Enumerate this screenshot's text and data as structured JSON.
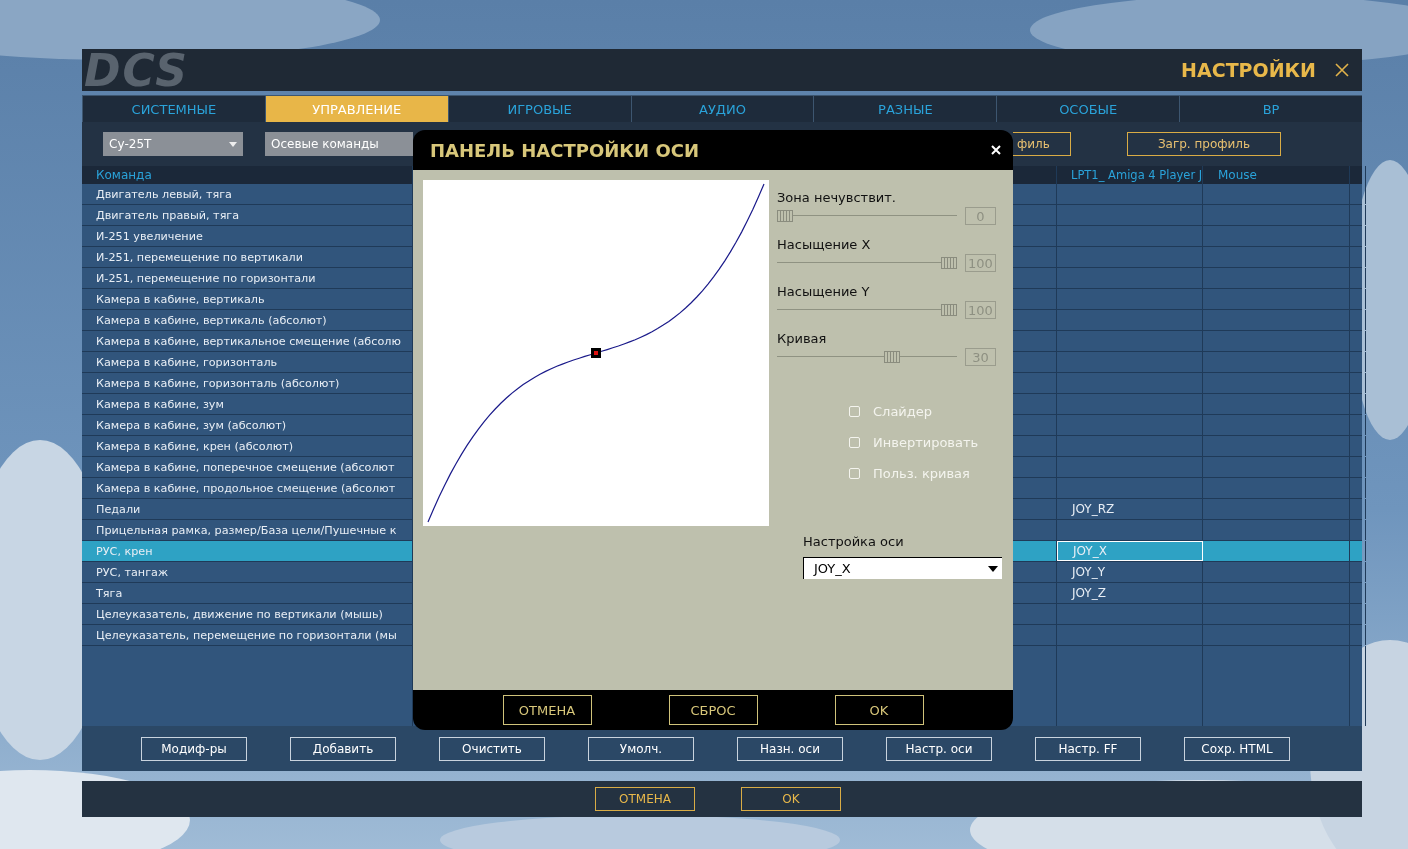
{
  "logo": "DCS",
  "window": {
    "title": "НАСТРОЙКИ"
  },
  "tabs": [
    {
      "label": "СИСТЕМНЫЕ",
      "selected": false
    },
    {
      "label": "УПРАВЛЕНИЕ",
      "selected": true
    },
    {
      "label": "ИГРОВЫЕ",
      "selected": false
    },
    {
      "label": "АУДИО",
      "selected": false
    },
    {
      "label": "РАЗНЫЕ",
      "selected": false
    },
    {
      "label": "ОСОБЫЕ",
      "selected": false
    },
    {
      "label": "ВР",
      "selected": false
    }
  ],
  "toolbar": {
    "aircraft": "Су-25Т",
    "category": "Осевые команды",
    "buttons": [
      "филь",
      "Загр. профиль"
    ]
  },
  "table": {
    "columns": [
      "Команда",
      "LPT1_ Amiga 4 Player J",
      "Mouse"
    ],
    "rows": [
      {
        "command": "Двигатель левый, тяга",
        "selected": false
      },
      {
        "command": "Двигатель правый, тяга",
        "selected": false
      },
      {
        "command": "И-251 увеличение",
        "selected": false
      },
      {
        "command": "И-251, перемещение по вертикали",
        "selected": false
      },
      {
        "command": "И-251, перемещение по горизонтали",
        "selected": false
      },
      {
        "command": "Камера в кабине, вертикаль",
        "selected": false
      },
      {
        "command": "Камера в кабине, вертикаль (абсолют)",
        "selected": false
      },
      {
        "command": "Камера в кабине, вертикальное смещение (абсолю",
        "selected": false
      },
      {
        "command": "Камера в кабине, горизонталь",
        "selected": false
      },
      {
        "command": "Камера в кабине, горизонталь (абсолют)",
        "selected": false
      },
      {
        "command": "Камера в кабине, зум",
        "selected": false
      },
      {
        "command": "Камера в кабине, зум (абсолют)",
        "selected": false
      },
      {
        "command": "Камера в кабине, крен (абсолют)",
        "selected": false
      },
      {
        "command": "Камера в кабине, поперечное смещение (абсолют",
        "selected": false
      },
      {
        "command": "Камера в кабине, продольное смещение (абсолют",
        "selected": false
      },
      {
        "command": "Педали",
        "joystick": "JOY_RZ",
        "selected": false
      },
      {
        "command": "Прицельная рамка, размер/База цели/Пушечные к",
        "selected": false
      },
      {
        "command": "РУС, крен",
        "joystick": "JOY_X",
        "selected": true
      },
      {
        "command": "РУС, тангаж",
        "joystick": "JOY_Y",
        "selected": false
      },
      {
        "command": "Тяга",
        "joystick": "JOY_Z",
        "selected": false
      },
      {
        "command": "Целеуказатель, движение по вертикали (мышь)",
        "selected": false
      },
      {
        "command": "Целеуказатель, перемещение по горизонтали (мы",
        "selected": false
      }
    ]
  },
  "actions": [
    "Модиф-ры",
    "Добавить",
    "Очистить",
    "Умолч.",
    "Назн. оси",
    "Настр. оси",
    "Настр. FF",
    "Сохр. HTML"
  ],
  "dialog": {
    "title": "ПАНЕЛЬ НАСТРОЙКИ ОСИ",
    "sliders": [
      {
        "label": "Зона нечувствит.",
        "level": 0,
        "reading": "0"
      },
      {
        "label": "Насыщение X",
        "level": 1,
        "reading": "100"
      },
      {
        "label": "Насыщение Y",
        "level": 1,
        "reading": "100"
      },
      {
        "label": "Кривая",
        "level": 0.65,
        "reading": "30"
      }
    ],
    "options": [
      {
        "label": "Слайдер",
        "checked": false
      },
      {
        "label": "Инвертировать",
        "checked": false
      },
      {
        "label": "Польз. кривая",
        "checked": false
      }
    ],
    "axis": {
      "label": "Настройка оси",
      "value": "JOY_X"
    },
    "buttons": [
      "ОТМЕНА",
      "СБРОС",
      "OK"
    ]
  },
  "footer": {
    "buttons": [
      "ОТМЕНА",
      "OK"
    ]
  }
}
